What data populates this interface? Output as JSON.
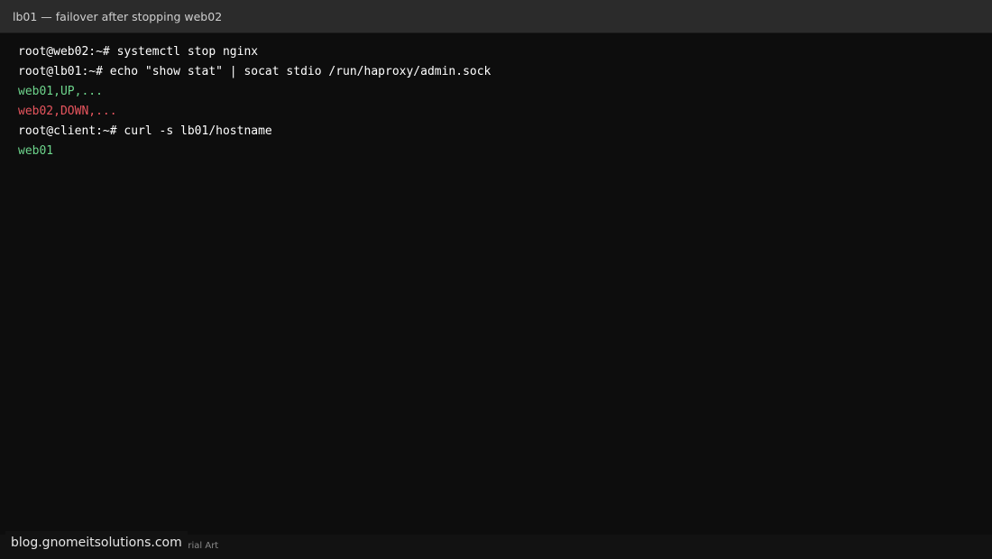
{
  "window": {
    "title": "lb01 — failover after stopping web02"
  },
  "terminal": {
    "lines": [
      "root@web02:~# systemctl stop nginx",
      "root@lb01:~# echo \"show stat\" | socat stdio /run/haproxy/admin.sock",
      "web01,UP,...",
      "web02,DOWN,...",
      "root@client:~# curl -s lb01/hostname",
      "web01"
    ]
  },
  "footer": {
    "text": "utorial Art"
  },
  "watermark": {
    "text": "blog.gnomeitsolutions.com"
  },
  "colors": {
    "titlebar": "#2b2b2b",
    "background": "#0d0d0d",
    "up": "#6dd58c",
    "down": "#e8555e",
    "text": "#ffffff"
  }
}
